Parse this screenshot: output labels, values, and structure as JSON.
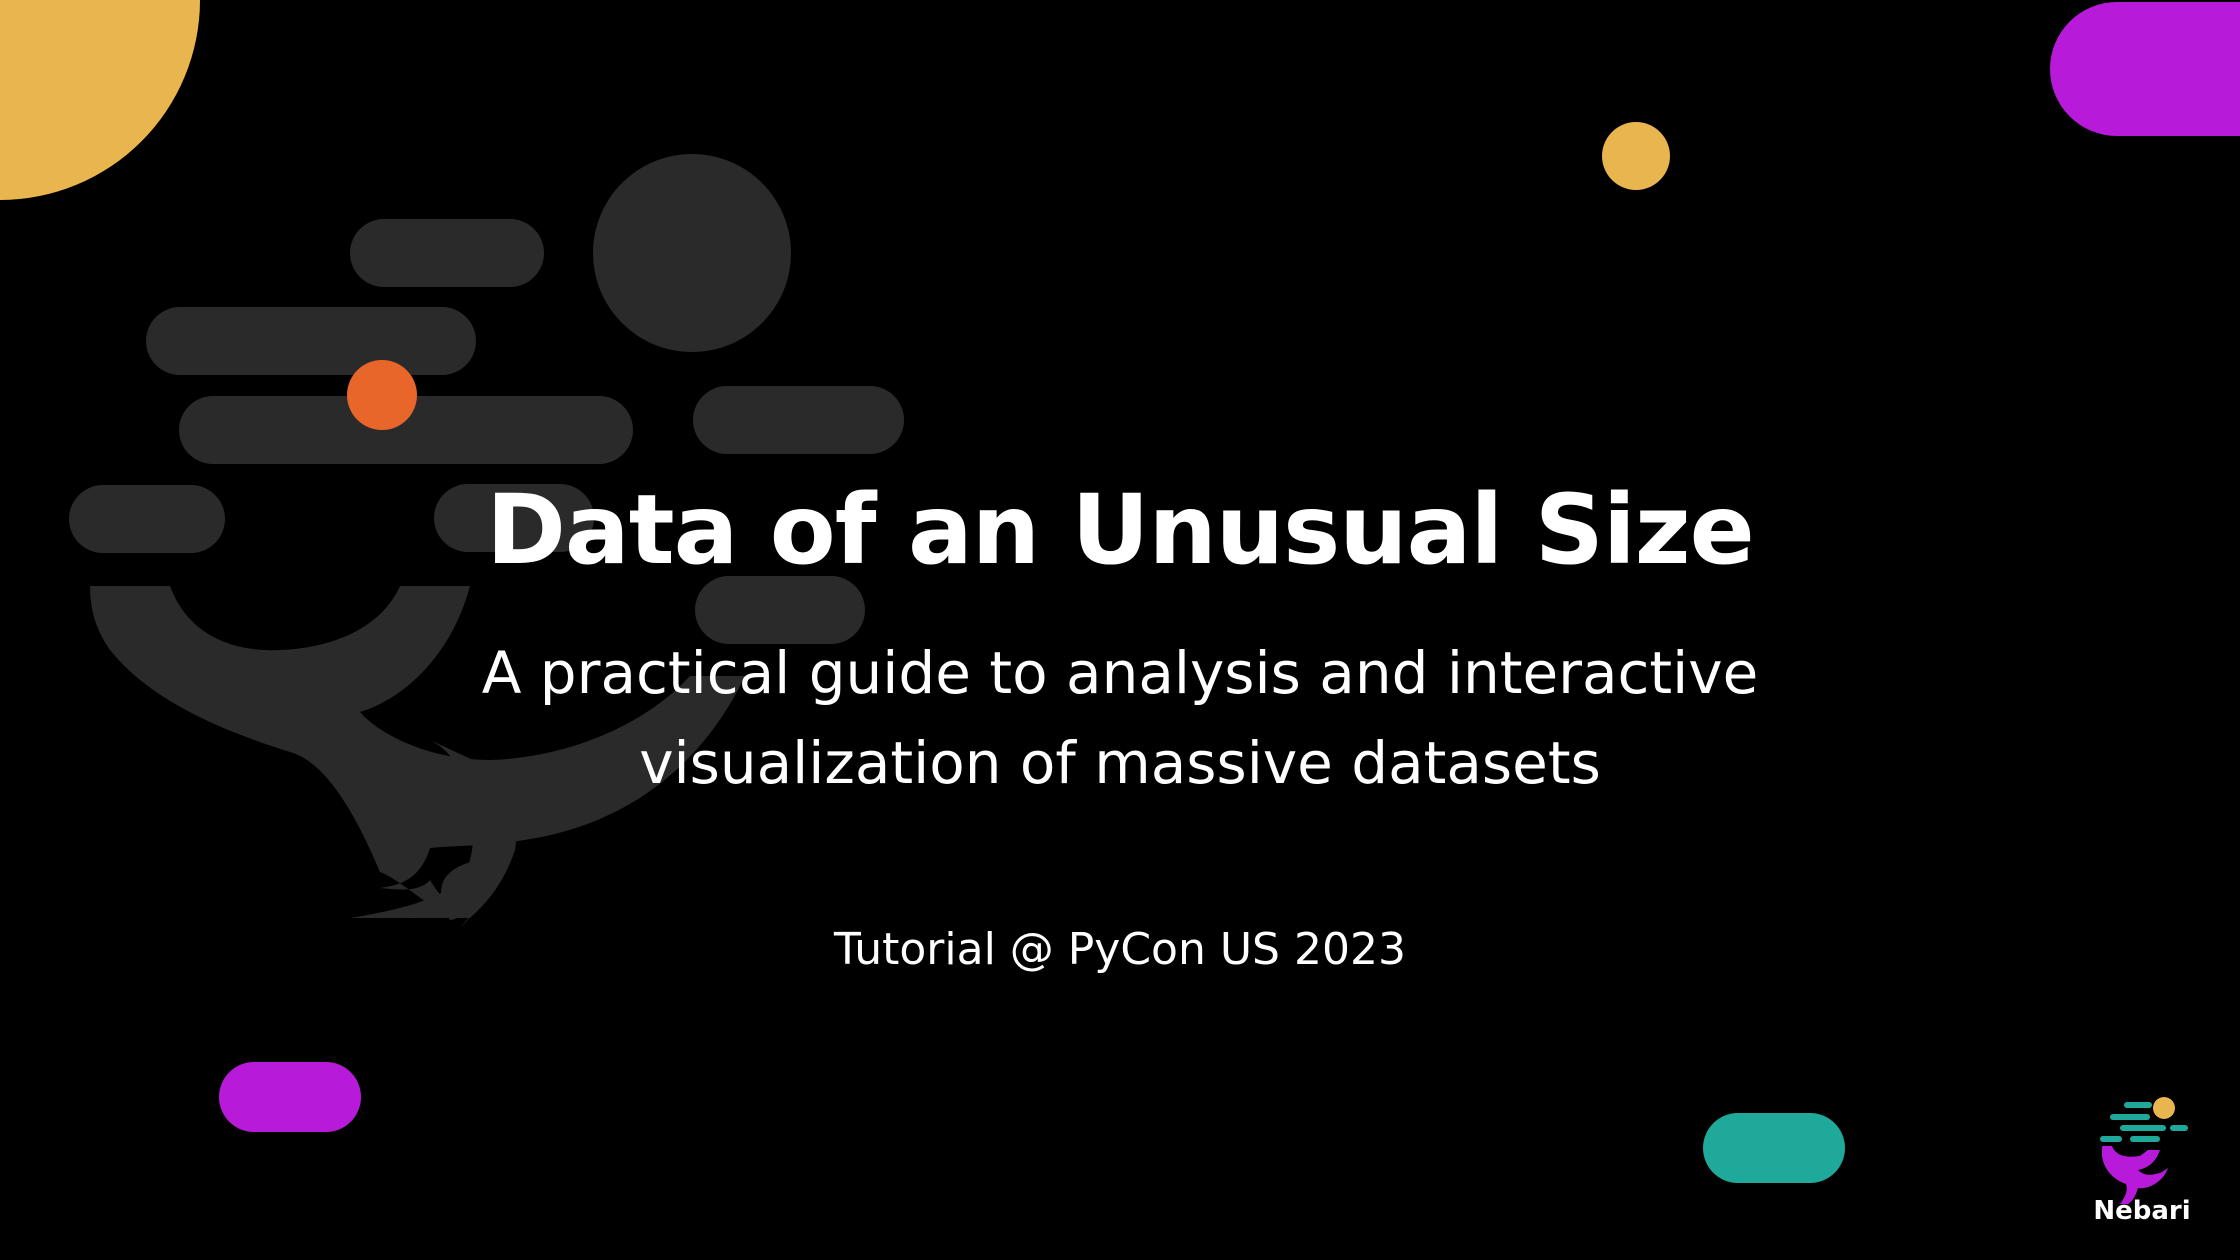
{
  "slide": {
    "title": "Data of an Unusual Size",
    "subtitle_lines": [
      "A practical guide to analysis and interactive",
      "visualization of massive datasets"
    ],
    "event": "Tutorial @ PyCon US 2023",
    "brand": "Nebari"
  },
  "colors": {
    "background": "#000000",
    "tree_gray": "#2a2a2a",
    "yellow": "#e9b54f",
    "magenta": "#b81ad9",
    "teal": "#1ea99b",
    "orange": "#e9662a",
    "text": "#ffffff"
  },
  "icons": {
    "background_art": "nebari-tree-graphic",
    "logo": "nebari-logo-icon"
  }
}
